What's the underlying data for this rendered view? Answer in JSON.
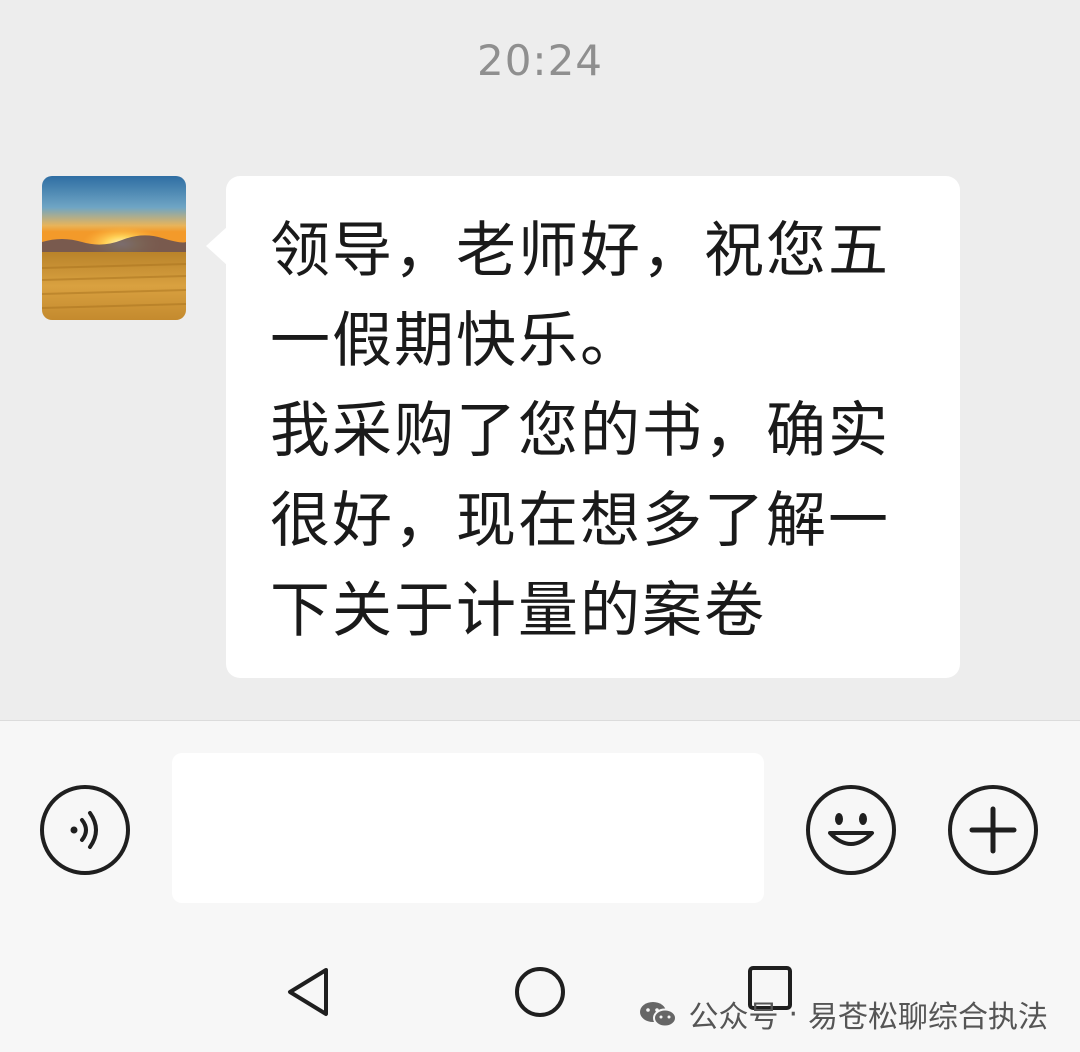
{
  "chat": {
    "timestamp": "20:24",
    "message": {
      "text": "领导，老师好，祝您五\n一假期快乐。\n我采购了您的书，确实\n很好，现在想多了解一\n下关于计量的案卷"
    }
  },
  "input_bar": {
    "voice_icon": "voice-wave-icon",
    "text_value": "",
    "emoji_icon": "smiley-icon",
    "plus_icon": "plus-icon"
  },
  "nav": {
    "back_icon": "triangle-back-icon",
    "home_icon": "circle-home-icon",
    "recent_icon": "square-recent-icon"
  },
  "watermark": {
    "prefix": "公众号",
    "separator": "·",
    "name": "易苍松聊综合执法"
  },
  "colors": {
    "chat_background": "#ededed",
    "bubble": "#ffffff",
    "input_bar": "#f7f7f7",
    "timestamp": "#8f8f8f"
  }
}
